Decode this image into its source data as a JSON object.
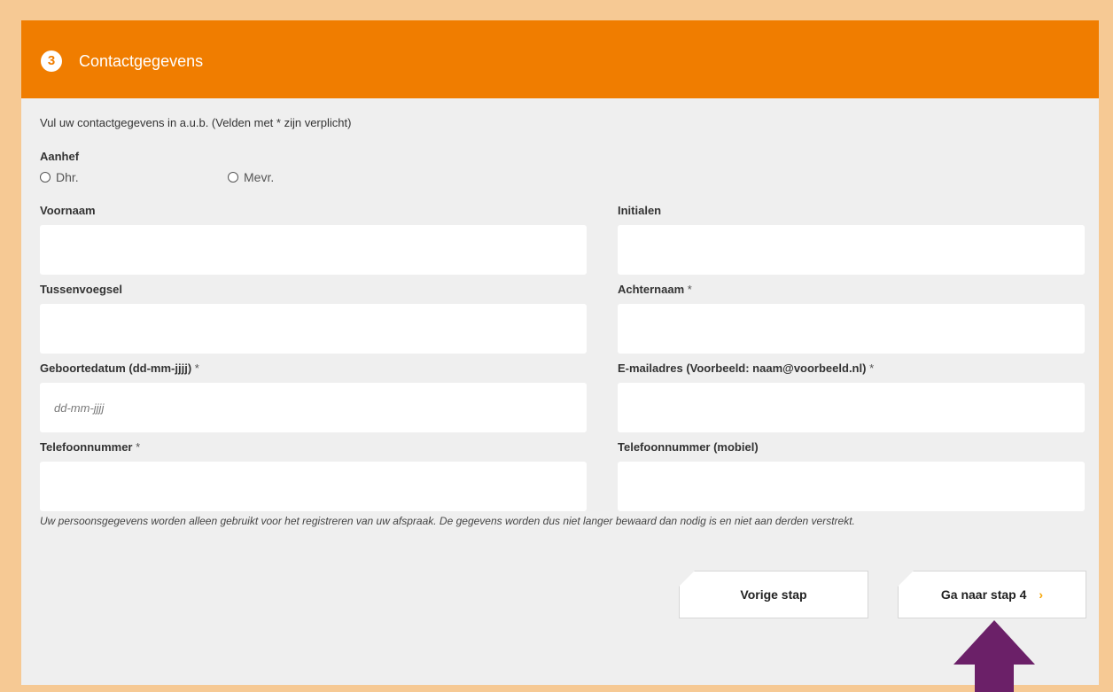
{
  "header": {
    "step_number": "3",
    "title": "Contactgegevens"
  },
  "intro": "Vul uw contactgegevens in a.u.b. (Velden met * zijn verplicht)",
  "salutation": {
    "label": "Aanhef",
    "options": [
      "Dhr.",
      "Mevr."
    ]
  },
  "fields": {
    "first_name": {
      "label": "Voornaam",
      "value": ""
    },
    "initials": {
      "label": "Initialen",
      "value": ""
    },
    "infix": {
      "label": "Tussenvoegsel",
      "value": ""
    },
    "last_name": {
      "label": "Achternaam",
      "required": "*",
      "value": ""
    },
    "birthdate": {
      "label": "Geboortedatum (dd-mm-jjjj)",
      "required": "*",
      "placeholder": "dd-mm-jjjj",
      "value": ""
    },
    "email": {
      "label": "E-mailadres (Voorbeeld: naam@voorbeeld.nl)",
      "required": "*",
      "value": ""
    },
    "phone": {
      "label": "Telefoonnummer",
      "required": "*",
      "value": ""
    },
    "mobile": {
      "label": "Telefoonnummer (mobiel)",
      "value": ""
    }
  },
  "privacy_note": "Uw persoonsgegevens worden alleen gebruikt voor het registreren van uw afspraak. De gegevens worden dus niet langer bewaard dan nodig is en niet aan derden verstrekt.",
  "buttons": {
    "previous": "Vorige stap",
    "next": "Ga naar stap 4",
    "next_icon": "›"
  },
  "colors": {
    "accent": "#f07d00",
    "border": "#f6c994",
    "panel": "#efefef",
    "arrow": "#6b2068"
  }
}
